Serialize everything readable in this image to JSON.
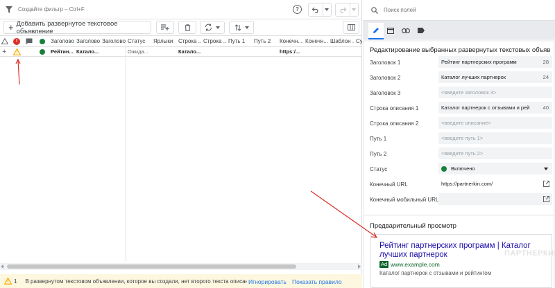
{
  "filterbar": {
    "placeholder": "Создайте фильтр – Ctrl+F",
    "help_icon": "question-circle-icon",
    "undo_icon": "undo-icon",
    "redo_icon": "redo-icon"
  },
  "toolbar": {
    "add_label": "Добавить развернутое текстовое объявление",
    "icons": [
      "playlist-add-icon",
      "trash-icon",
      "replace-icon",
      "sort-icon",
      "columns-icon"
    ]
  },
  "grid": {
    "headers": [
      "Заголовок 1",
      "Заголовок 2",
      "Заголовок 3",
      "Статус",
      "Ярлыки",
      "Строка ...",
      "Строка ...",
      "Путь 1",
      "Путь 2",
      "Конечн...",
      "Конечн...",
      "Шаблон ...",
      "Суф"
    ],
    "row": {
      "h1": "Рейтин...",
      "h2": "Катало...",
      "status": "Ожида...",
      "desc1": "Катало...",
      "url": "https:/..."
    }
  },
  "warning": {
    "count": "1",
    "message": "В развернутом текстовом объявлении, которое вы создали, нет второго текста описан...",
    "ignore": "Игнорировать",
    "show_rule": "Показать правило"
  },
  "side": {
    "search_placeholder": "Поиск полей",
    "tabs": [
      "edit-icon",
      "browser-icon",
      "link-icon",
      "label-icon"
    ],
    "panel_title": "Редактирование выбранных развернутых текстовых объявлений",
    "fields": [
      {
        "label": "Заголовок 1",
        "value": "Рейтинг партнерских программ",
        "count": "28",
        "placeholder": false
      },
      {
        "label": "Заголовок 2",
        "value": "Каталог лучших партнерок",
        "count": "24",
        "placeholder": false
      },
      {
        "label": "Заголовок 3",
        "value": "<введите заголовок 3>",
        "count": "",
        "placeholder": true
      },
      {
        "label": "Строка описания 1",
        "value": "Каталог партнерок с отзывами и рейти",
        "count": "40",
        "placeholder": false
      },
      {
        "label": "Строка описания 2",
        "value": "<введите описание>",
        "count": "",
        "placeholder": true
      },
      {
        "label": "Путь 1",
        "value": "<введите путь 1>",
        "count": "",
        "placeholder": true
      },
      {
        "label": "Путь 2",
        "value": "<введите путь 2>",
        "count": "",
        "placeholder": true
      }
    ],
    "status_label": "Статус",
    "status_value": "Включено",
    "final_url_label": "Конечный URL",
    "final_url_value": "https://partnerkin.com/",
    "mobile_url_label": "Конечный мобильный URL",
    "mobile_url_value": "",
    "preview_title": "Предварительный просмотр",
    "ad": {
      "headline": "Рейтинг партнерских программ | Каталог лучших партнерок",
      "badge": "Ad",
      "display_url": "www.example.com",
      "description": "Каталог партнерок с отзывами и рейтингом"
    },
    "watermark": "ПАРТНЕРКИН"
  },
  "colors": {
    "accent": "#1a73e8",
    "error": "#d93025",
    "warning": "#f9ab00",
    "enabled": "#188038"
  }
}
